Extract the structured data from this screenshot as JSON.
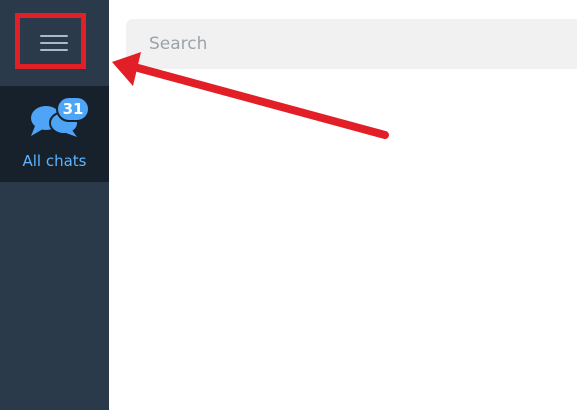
{
  "sidebar": {
    "menu_icon": "hamburger-menu-icon",
    "folders": [
      {
        "label": "All chats",
        "icon": "chat-bubbles-icon",
        "badge": "31"
      }
    ]
  },
  "search": {
    "placeholder": "Search"
  },
  "colors": {
    "sidebar_bg": "#2b3a4b",
    "folder_active_bg": "#17212b",
    "accent": "#4ea4f6",
    "annotation_red": "#e21f26"
  }
}
